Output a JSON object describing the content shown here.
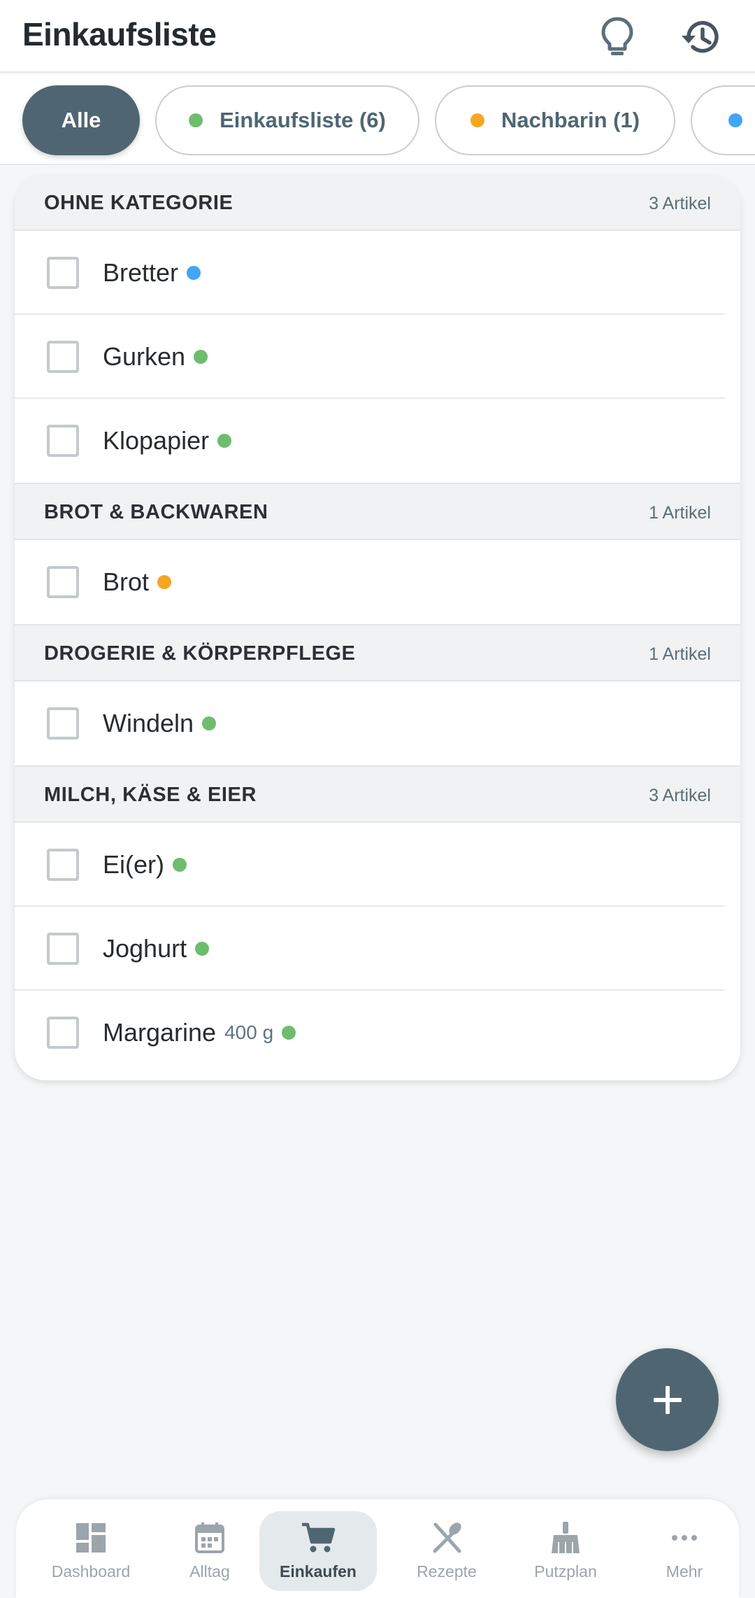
{
  "header": {
    "title": "Einkaufsliste",
    "icons": [
      "lightbulb-icon",
      "history-icon"
    ]
  },
  "filters": {
    "chips": [
      {
        "label": "Alle",
        "active": true,
        "color": null
      },
      {
        "label": "Einkaufsliste (6)",
        "active": false,
        "color": "#6dbd6d"
      },
      {
        "label": "Nachbarin (1)",
        "active": false,
        "color": "#f5a623"
      },
      {
        "label": "",
        "active": false,
        "color": "#42a5f5"
      }
    ]
  },
  "colors": {
    "primary": "#4f6672",
    "green": "#6dbd6d",
    "orange": "#f5a623",
    "blue": "#42a5f5"
  },
  "sections": [
    {
      "name": "OHNE KATEGORIE",
      "count": "3 Artikel",
      "items": [
        {
          "label": "Bretter",
          "qty": "",
          "color": "#42a5f5"
        },
        {
          "label": "Gurken",
          "qty": "",
          "color": "#6dbd6d"
        },
        {
          "label": "Klopapier",
          "qty": "",
          "color": "#6dbd6d"
        }
      ]
    },
    {
      "name": "BROT & BACKWAREN",
      "count": "1 Artikel",
      "items": [
        {
          "label": "Brot",
          "qty": "",
          "color": "#f5a623"
        }
      ]
    },
    {
      "name": "DROGERIE & KÖRPERPFLEGE",
      "count": "1 Artikel",
      "items": [
        {
          "label": "Windeln",
          "qty": "",
          "color": "#6dbd6d"
        }
      ]
    },
    {
      "name": "MILCH, KÄSE & EIER",
      "count": "3 Artikel",
      "items": [
        {
          "label": "Ei(er)",
          "qty": "",
          "color": "#6dbd6d"
        },
        {
          "label": "Joghurt",
          "qty": "",
          "color": "#6dbd6d"
        },
        {
          "label": "Margarine",
          "qty": "400 g",
          "color": "#6dbd6d"
        }
      ]
    }
  ],
  "fab": {
    "icon": "plus-icon"
  },
  "bottom_nav": {
    "items": [
      {
        "label": "Dashboard",
        "icon": "dashboard-icon",
        "active": false
      },
      {
        "label": "Alltag",
        "icon": "calendar-icon",
        "active": false
      },
      {
        "label": "Einkaufen",
        "icon": "cart-icon",
        "active": true
      },
      {
        "label": "Rezepte",
        "icon": "utensils-icon",
        "active": false
      },
      {
        "label": "Putzplan",
        "icon": "broom-icon",
        "active": false
      },
      {
        "label": "Mehr",
        "icon": "more-icon",
        "active": false
      }
    ]
  }
}
